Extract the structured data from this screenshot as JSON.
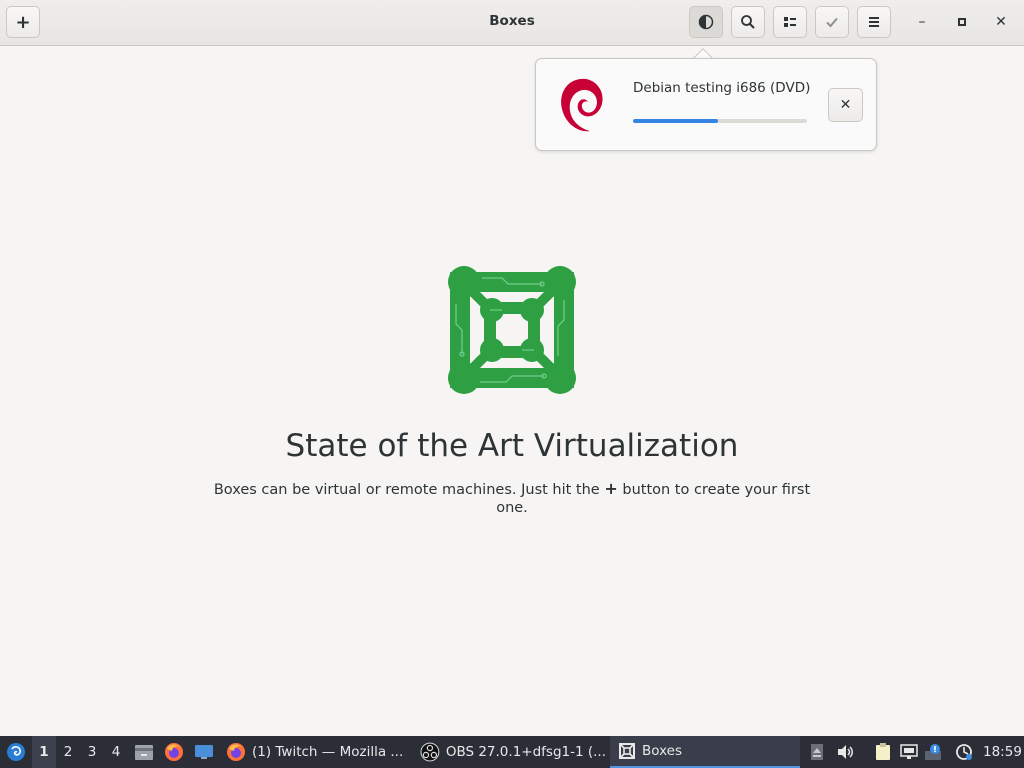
{
  "window": {
    "title": "Boxes",
    "new_button_label": "+",
    "minimize_label": "–",
    "maximize_label": "▫",
    "close_label": "✕"
  },
  "header_buttons": [
    {
      "name": "downloads-button",
      "icon": "half-circle-icon"
    },
    {
      "name": "search-button",
      "icon": "search-icon"
    },
    {
      "name": "view-toggle-button",
      "icon": "list-view-icon"
    },
    {
      "name": "selection-mode-button",
      "icon": "checkmark-icon"
    },
    {
      "name": "main-menu-button",
      "icon": "hamburger-icon"
    }
  ],
  "download": {
    "name": "Debian testing i686 (DVD)",
    "progress": 0.49,
    "cancel_label": "✕",
    "icon": "debian-swirl-icon",
    "icon_color": "#c70036"
  },
  "empty_state": {
    "title": "State of the Art Virtualization",
    "desc_before": "Boxes can be virtual or remote machines. Just hit the ",
    "desc_plus": "+",
    "desc_after": " button to create your first one.",
    "logo": "boxes-circuit-logo",
    "logo_color": "#2ea043"
  },
  "taskbar": {
    "workspaces": [
      "1",
      "2",
      "3",
      "4"
    ],
    "active_workspace": "1",
    "launchers": [
      "file-manager-icon",
      "firefox-icon",
      "desktop-icon"
    ],
    "tasks": [
      {
        "label": "(1) Twitch — Mozilla ...",
        "icon": "firefox-icon"
      },
      {
        "label": "OBS 27.0.1+dfsg1-1 (...",
        "icon": "obs-icon"
      },
      {
        "label": "Boxes",
        "icon": "boxes-icon"
      }
    ],
    "tray": [
      "eject-icon",
      "volume-icon",
      "clipboard-icon",
      "network-icon",
      "notification-icon",
      "update-icon"
    ],
    "clock": "18:59"
  },
  "colors": {
    "accent": "#3584e4",
    "taskbar_bg": "#2b2e37",
    "window_bg": "#f6f5f4"
  }
}
